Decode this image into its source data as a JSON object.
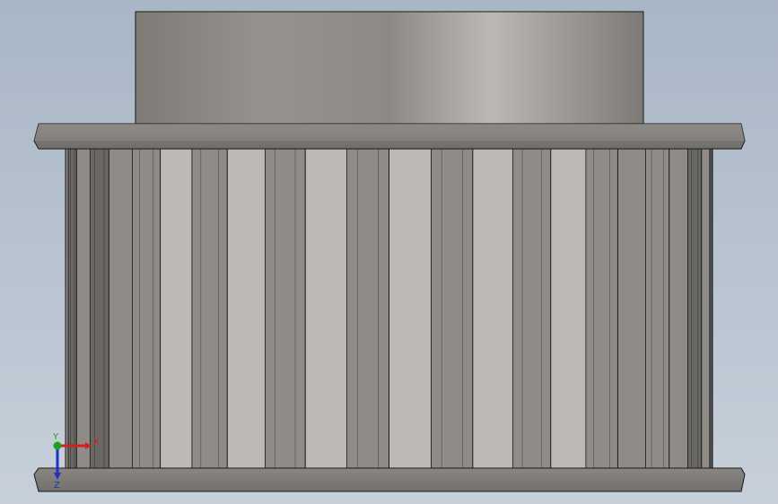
{
  "viewport": {
    "background_top_color": "#a9b6c6",
    "background_bottom_color": "#c7d0da",
    "model": {
      "name": "timing-belt-pulley",
      "view": "front",
      "teeth_visible": 12,
      "metal_light": "#bdbab6",
      "metal_mid": "#8f8c88",
      "metal_dark": "#6a6864",
      "edge_color": "#1a1a1a"
    }
  },
  "triad": {
    "x_label": "X",
    "y_label": "Y",
    "z_label": "Z",
    "x_color": "#d42020",
    "y_color": "#20a020",
    "z_color": "#2030c0"
  }
}
